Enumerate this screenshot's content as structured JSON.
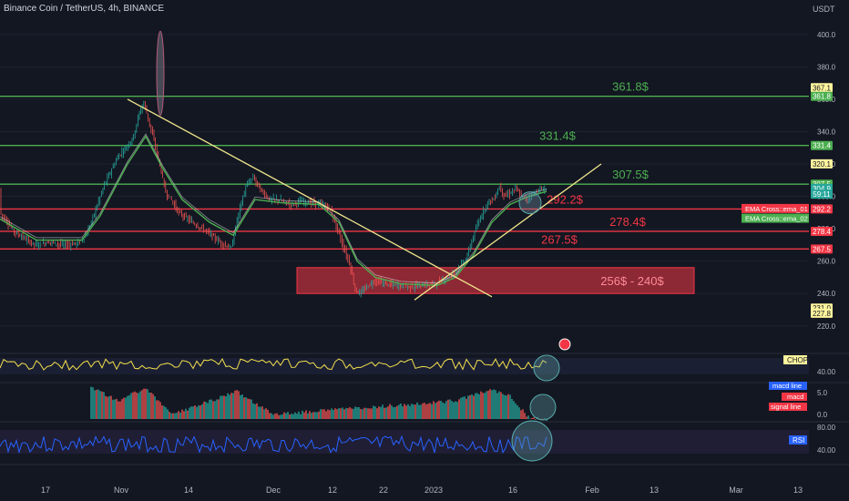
{
  "header": {
    "symbol_title": "Binance Coin / TetherUS, 4h, BINANCE",
    "currency": "USDT"
  },
  "chart_data": {
    "type": "candlestick",
    "title": "Binance Coin / TetherUS, 4h, BINANCE",
    "ylim": [
      212,
      410
    ],
    "y_ticks": [
      220,
      240,
      260,
      280,
      300,
      320,
      340,
      360,
      380,
      400
    ],
    "x_ticks": [
      "17",
      "Nov",
      "14",
      "Dec",
      "12",
      "22",
      "2023",
      "16",
      "Feb",
      "13",
      "Mar",
      "13"
    ],
    "price_series": [
      [
        0,
        290
      ],
      [
        8,
        284
      ],
      [
        16,
        278
      ],
      [
        24,
        275
      ],
      [
        32,
        272
      ],
      [
        40,
        270
      ],
      [
        55,
        272
      ],
      [
        70,
        270
      ],
      [
        85,
        271
      ],
      [
        95,
        276
      ],
      [
        105,
        292
      ],
      [
        115,
        308
      ],
      [
        122,
        316
      ],
      [
        130,
        325
      ],
      [
        138,
        330
      ],
      [
        146,
        336
      ],
      [
        152,
        350
      ],
      [
        158,
        358
      ],
      [
        164,
        345
      ],
      [
        170,
        332
      ],
      [
        176,
        318
      ],
      [
        182,
        302
      ],
      [
        188,
        298
      ],
      [
        196,
        290
      ],
      [
        206,
        286
      ],
      [
        216,
        282
      ],
      [
        226,
        279
      ],
      [
        236,
        274
      ],
      [
        246,
        270
      ],
      [
        254,
        268
      ],
      [
        262,
        290
      ],
      [
        270,
        306
      ],
      [
        278,
        312
      ],
      [
        286,
        304
      ],
      [
        296,
        298
      ],
      [
        306,
        298
      ],
      [
        318,
        295
      ],
      [
        330,
        297
      ],
      [
        342,
        296
      ],
      [
        352,
        295
      ],
      [
        360,
        294
      ],
      [
        368,
        284
      ],
      [
        376,
        270
      ],
      [
        384,
        258
      ],
      [
        390,
        242
      ],
      [
        396,
        240
      ],
      [
        402,
        244
      ],
      [
        412,
        248
      ],
      [
        424,
        246
      ],
      [
        436,
        245
      ],
      [
        450,
        244
      ],
      [
        464,
        245
      ],
      [
        478,
        246
      ],
      [
        492,
        250
      ],
      [
        502,
        255
      ],
      [
        512,
        262
      ],
      [
        520,
        276
      ],
      [
        528,
        288
      ],
      [
        536,
        297
      ],
      [
        542,
        298
      ],
      [
        548,
        306
      ],
      [
        554,
        300
      ],
      [
        560,
        302
      ],
      [
        566,
        305
      ],
      [
        572,
        300
      ],
      [
        578,
        298
      ],
      [
        586,
        302
      ],
      [
        594,
        304
      ],
      [
        600,
        304.9
      ]
    ],
    "ema_series": [
      [
        0,
        286
      ],
      [
        40,
        273
      ],
      [
        90,
        273
      ],
      [
        110,
        288
      ],
      [
        140,
        320
      ],
      [
        160,
        337
      ],
      [
        178,
        318
      ],
      [
        200,
        298
      ],
      [
        230,
        284
      ],
      [
        256,
        276
      ],
      [
        280,
        298
      ],
      [
        310,
        296
      ],
      [
        350,
        295
      ],
      [
        372,
        284
      ],
      [
        392,
        260
      ],
      [
        412,
        250
      ],
      [
        440,
        246
      ],
      [
        480,
        245
      ],
      [
        500,
        250
      ],
      [
        520,
        264
      ],
      [
        540,
        284
      ],
      [
        560,
        295
      ],
      [
        580,
        300
      ],
      [
        600,
        303
      ]
    ],
    "spike_ellipse_price": [
      402,
      350
    ],
    "trendlines": [
      {
        "from": [
          140,
          360
        ],
        "to": [
          540,
          238
        ],
        "color": "#f0e68c"
      },
      {
        "from": [
          455,
          236
        ],
        "to": [
          660,
          320
        ],
        "color": "#f0e68c"
      }
    ],
    "horizontal_levels": [
      {
        "price": 361.8,
        "label": "361.8$",
        "color": "#4caf50"
      },
      {
        "price": 331.4,
        "label": "331.4$",
        "color": "#4caf50"
      },
      {
        "price": 307.5,
        "label": "307.5$",
        "color": "#4caf50"
      },
      {
        "price": 292.2,
        "label": "292.2$",
        "color": "#f23645"
      },
      {
        "price": 278.4,
        "label": "278.4$",
        "color": "#f23645"
      },
      {
        "price": 267.5,
        "label": "267.5$",
        "color": "#f23645"
      }
    ],
    "support_zone": {
      "top": 256,
      "bottom": 240,
      "label": "256$ - 240$"
    },
    "price_axis_badges": [
      {
        "text": "367.1",
        "price": 367.1,
        "bg": "#fff59d",
        "fg": "#131722"
      },
      {
        "text": "361.8",
        "price": 361.8,
        "bg": "#4caf50",
        "fg": "#ffffff"
      },
      {
        "text": "331.4",
        "price": 331.4,
        "bg": "#4caf50",
        "fg": "#ffffff"
      },
      {
        "text": "320.1",
        "price": 320.1,
        "bg": "#fff59d",
        "fg": "#131722"
      },
      {
        "text": "307.5",
        "price": 307.5,
        "bg": "#4caf50",
        "fg": "#ffffff"
      },
      {
        "text": "304.9",
        "price": 304.9,
        "bg": "#26a69a",
        "fg": "#ffffff"
      },
      {
        "text": "59:11",
        "price": 301.4,
        "bg": "#26a69a",
        "fg": "#ffffff"
      },
      {
        "text": "292.2",
        "price": 292.2,
        "bg": "#f23645",
        "fg": "#ffffff"
      },
      {
        "text": "278.4",
        "price": 278.4,
        "bg": "#f23645",
        "fg": "#ffffff"
      },
      {
        "text": "267.5",
        "price": 267.5,
        "bg": "#f23645",
        "fg": "#ffffff"
      },
      {
        "text": "231.0",
        "price": 231.0,
        "bg": "#fff59d",
        "fg": "#131722"
      },
      {
        "text": "227.8",
        "price": 227.8,
        "bg": "#fff59d",
        "fg": "#131722"
      }
    ],
    "indicator_labels": [
      {
        "text": "EMA Cross::ema_01",
        "price": 292.5,
        "bg": "#f23645"
      },
      {
        "text": "EMA Cross::ema_02",
        "price": 286.5,
        "bg": "#4caf50"
      }
    ],
    "circle_highlights": [
      {
        "x": 582,
        "price": 296
      }
    ],
    "panes": {
      "chop": {
        "label": "CHOP",
        "ticks": [
          "40.00"
        ]
      },
      "macd": {
        "labels": [
          "macd line",
          "macd",
          "signal line"
        ],
        "ticks": [
          "5.0",
          "0.0"
        ]
      },
      "rsi": {
        "label": "RSI",
        "ticks": [
          "80.00",
          "40.00"
        ]
      }
    },
    "flag_icon": "us-flag-icon"
  }
}
